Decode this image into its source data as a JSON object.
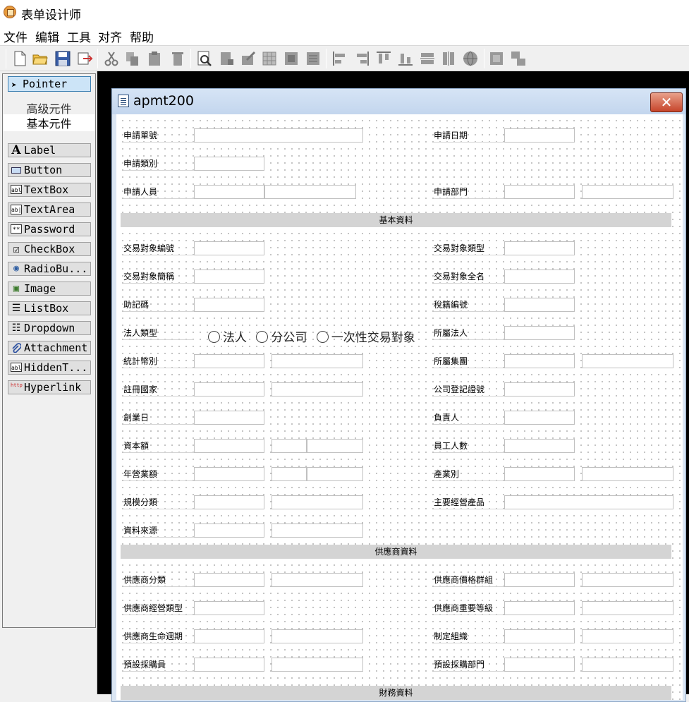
{
  "app": {
    "title": "表单设计师"
  },
  "menu": [
    "文件",
    "编辑",
    "工具",
    "对齐",
    "帮助"
  ],
  "toolbar": {
    "buttons": [
      "new-file-icon",
      "open-folder-icon",
      "save-icon",
      "export-icon",
      "cut-icon",
      "copy-icon",
      "paste-icon",
      "delete-icon",
      "preview-icon",
      "properties-icon",
      "edit-icon",
      "grid-icon",
      "bring-front-icon",
      "send-back-icon",
      "align-left-icon",
      "align-right-icon",
      "align-top-icon",
      "align-bottom-icon",
      "same-width-icon",
      "same-height-icon",
      "globe-icon",
      "group-icon",
      "ungroup-icon"
    ]
  },
  "palette": {
    "pointer": "Pointer",
    "tab_advanced": "高级元件",
    "tab_basic": "基本元件",
    "components": [
      "Label",
      "Button",
      "TextBox",
      "TextArea",
      "Password",
      "CheckBox",
      "RadioBu...",
      "Image",
      "ListBox",
      "Dropdown",
      "Attachment",
      "HiddenT...",
      "Hyperlink"
    ],
    "icons": [
      "A",
      "▭",
      "abl",
      "ab|",
      "**",
      "☑",
      "◉",
      "▣",
      "☰",
      "☷",
      "𝒬",
      "abl",
      "http"
    ]
  },
  "form": {
    "title": "apmt200",
    "close": "✕",
    "sections": [
      "基本資料",
      "供應商資料",
      "財務資料"
    ],
    "labels": {
      "apply_no": "申請單號",
      "apply_date": "申請日期",
      "apply_type": "申請類別",
      "applicant": "申請人員",
      "apply_dept": "申請部門",
      "party_no": "交易對象編號",
      "party_type": "交易對象類型",
      "party_short": "交易對象簡稱",
      "party_full": "交易對象全名",
      "mnemonic": "助記碼",
      "tax_no": "稅籍編號",
      "legal_type": "法人類型",
      "belong_legal": "所屬法人",
      "currency": "統計幣別",
      "belong_group": "所屬集團",
      "country": "註冊國家",
      "company_reg": "公司登記證號",
      "founded": "創業日",
      "owner": "負責人",
      "capital": "資本額",
      "employees": "員工人數",
      "revenue": "年營業額",
      "industry": "產業別",
      "scale": "規模分類",
      "main_products": "主要經營產品",
      "source": "資料來源",
      "supplier_class": "供應商分類",
      "supplier_price_group": "供應商價格群組",
      "supplier_biz_type": "供應商經營類型",
      "supplier_importance": "供應商重要等級",
      "supplier_lifecycle": "供應商生命週期",
      "org": "制定組織",
      "buyer": "預設採購員",
      "buyer_dept": "預設採購部門"
    },
    "legal_type_options": [
      "法人",
      "分公司",
      "一次性交易對象"
    ]
  }
}
